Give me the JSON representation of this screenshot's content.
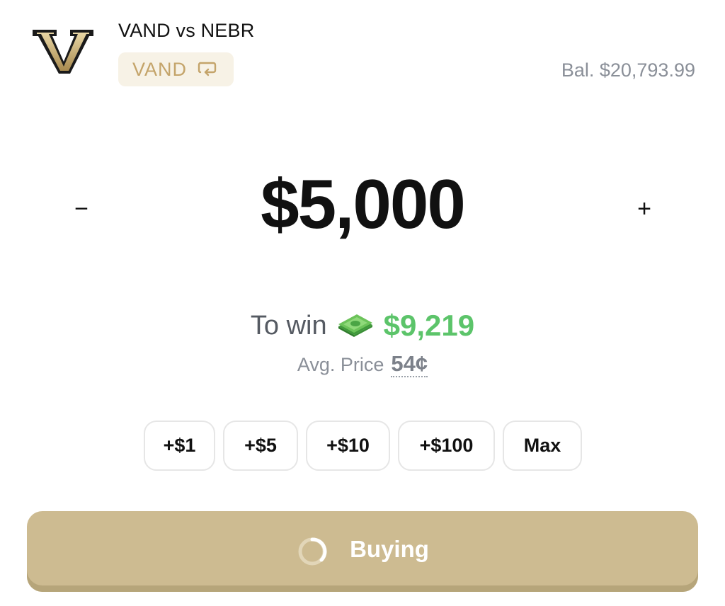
{
  "header": {
    "matchup_title": "VAND vs NEBR",
    "team_chip_label": "VAND",
    "balance": "Bal. $20,793.99"
  },
  "amount": {
    "minus_label": "−",
    "value": "$5,000",
    "plus_label": "+"
  },
  "payout": {
    "to_win_label": "To win",
    "to_win_value": "$9,219",
    "avg_price_label": "Avg. Price",
    "avg_price_value": "54¢"
  },
  "quick_add": [
    "+$1",
    "+$5",
    "+$10",
    "+$100",
    "Max"
  ],
  "buy_button": {
    "label": "Buying"
  },
  "icons": {
    "team_logo": "vanderbilt-v-logo-icon",
    "swap": "swap-icon",
    "money": "money-bill-icon",
    "spinner": "loading-spinner-icon"
  },
  "colors": {
    "accent_gold": "#cdbb91",
    "chip_bg": "#f7f2e6",
    "chip_text": "#c4a46a",
    "win_green": "#5cc46a",
    "muted_gray": "#8a8f98"
  }
}
